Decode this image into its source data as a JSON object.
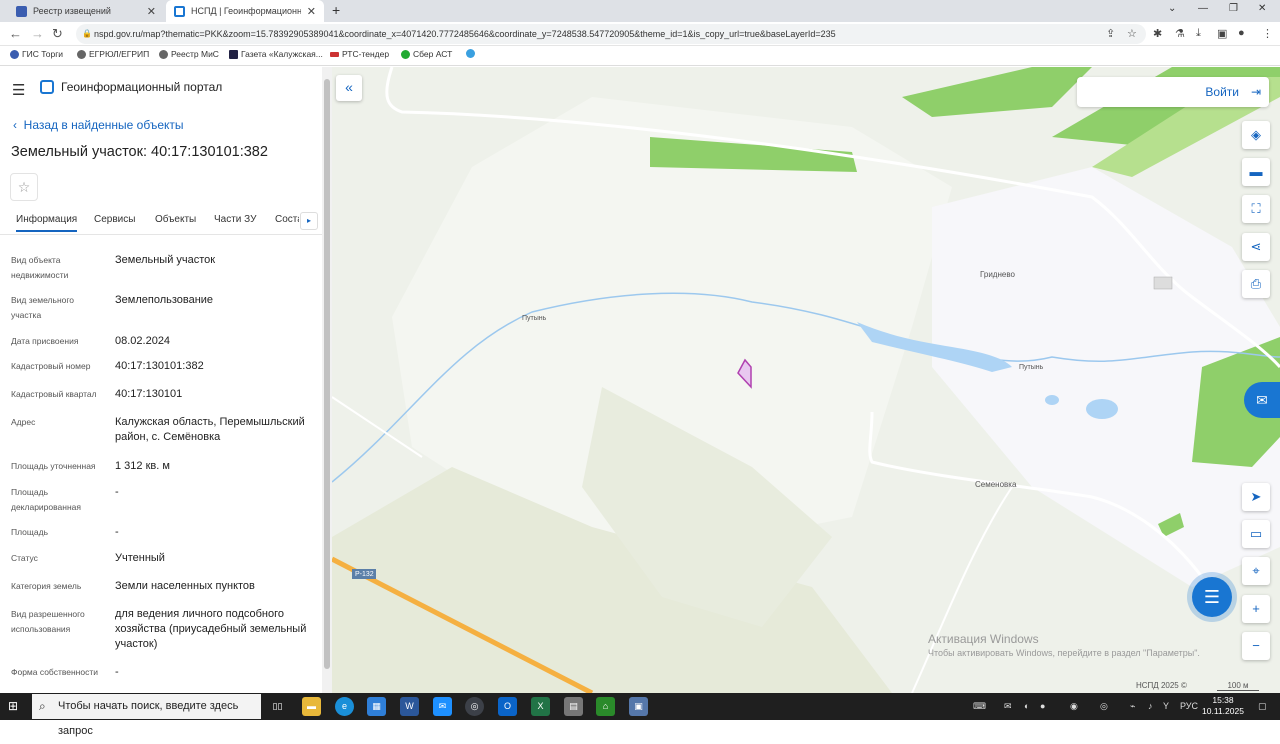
{
  "browser": {
    "tabs": [
      {
        "title": "Реестр извещений",
        "active": false
      },
      {
        "title": "НСПД | Геоинформационный п",
        "active": true
      }
    ],
    "url": "nspd.gov.ru/map?thematic=PKK&zoom=15.78392905389041&coordinate_x=4071420.7772485646&coordinate_y=7248538.547720905&theme_id=1&is_copy_url=true&baseLayerId=235",
    "bookmarks": [
      "ГИС Торги",
      "ЕГРЮЛ/ЕГРИП",
      "Реестр МиС",
      "Газета «Калужская...",
      "РТС-тендер",
      "Сбер АСТ"
    ]
  },
  "portal": {
    "title": "Геоинформационный портал",
    "back_label": "Назад в найденные объекты",
    "heading": "Земельный участок: 40:17:130101:382",
    "tabs": [
      "Информация",
      "Сервисы",
      "Объекты",
      "Части ЗУ",
      "Соста"
    ],
    "fields": [
      {
        "label": "Вид объекта недвижимости",
        "value": "Земельный участок"
      },
      {
        "label": "Вид земельного участка",
        "value": "Землепользование"
      },
      {
        "label": "Дата присвоения",
        "value": "08.02.2024"
      },
      {
        "label": "Кадастровый номер",
        "value": "40:17:130101:382"
      },
      {
        "label": "Кадастровый квартал",
        "value": "40:17:130101"
      },
      {
        "label": "Адрес",
        "value": "Калужская область, Перемышльский район, с. Семёновка"
      },
      {
        "label": "Площадь уточненная",
        "value": "1 312 кв. м"
      },
      {
        "label": "Площадь декларированная",
        "value": "-"
      },
      {
        "label": "Площадь",
        "value": "-"
      },
      {
        "label": "Статус",
        "value": "Учтенный"
      },
      {
        "label": "Категория земель",
        "value": "Земли населенных пунктов"
      },
      {
        "label": "Вид разрешенного использования",
        "value": "для ведения личного подсобного хозяйства (приусадебный земельный участок)"
      },
      {
        "label": "Форма собственности",
        "value": "-"
      }
    ]
  },
  "map": {
    "login_label": "Войти",
    "labels": {
      "village1": "Гриднево",
      "village2": "Семеновка",
      "river1": "Путынь",
      "river2": "Путынь",
      "road": "Р-132"
    },
    "watermark_title": "Активация Windows",
    "watermark_text": "Чтобы активировать Windows, перейдите в раздел \"Параметры\".",
    "copyright": "НСПД 2025 ©",
    "scale": "100 м"
  },
  "taskbar": {
    "search_placeholder": "Чтобы начать поиск, введите здесь запрос",
    "lang": "РУС",
    "time": "15:38",
    "date": "10.11.2025"
  },
  "colors": {
    "accent": "#1565c0",
    "parcel": "#b040b0",
    "water": "#aed4f5",
    "forest": "#8fcf6a"
  }
}
